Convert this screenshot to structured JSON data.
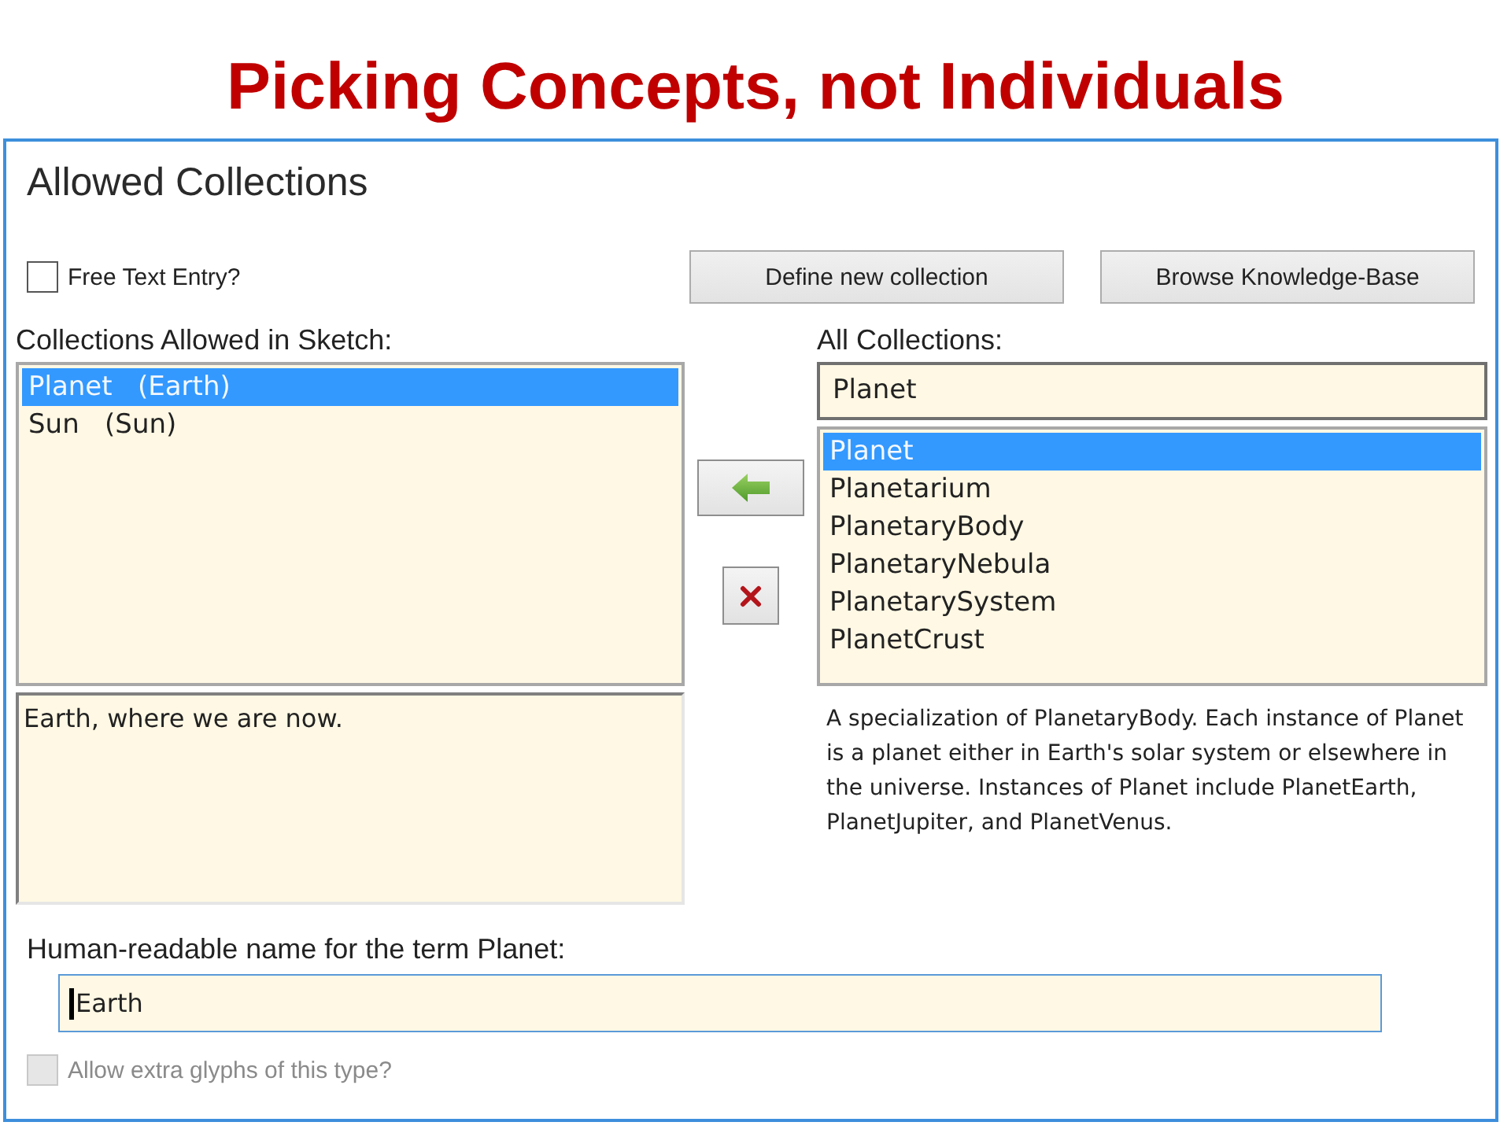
{
  "slide_title": "Picking Concepts, not Individuals",
  "dialog": {
    "title": "Allowed Collections",
    "free_text": {
      "label": "Free Text Entry?",
      "checked": false,
      "disabled": false
    },
    "buttons": [
      "Define new collection",
      "Browse Knowledge-Base"
    ],
    "allowed_list": {
      "label": "Collections Allowed in Sketch:",
      "items": [
        {
          "label": "Planet   (Earth)",
          "selected": true
        },
        {
          "label": "Sun   (Sun)",
          "selected": false
        }
      ]
    },
    "description": "Earth, where we are now.",
    "all_collections": {
      "label": "All Collections:",
      "search_value": "Planet",
      "items": [
        {
          "label": "Planet",
          "selected": true
        },
        {
          "label": "Planetarium",
          "selected": false
        },
        {
          "label": "PlanetaryBody",
          "selected": false
        },
        {
          "label": "PlanetaryNebula",
          "selected": false
        },
        {
          "label": "PlanetarySystem",
          "selected": false
        },
        {
          "label": "PlanetCrust",
          "selected": false
        }
      ]
    },
    "definition": "A specialization of PlanetaryBody. Each instance of Planet is a planet either in Earth's solar system or elsewhere in the universe. Instances of Planet include PlanetEarth, PlanetJupiter, and PlanetVenus.",
    "name_field": {
      "label": "Human-readable name for the term Planet:",
      "value": "Earth",
      "cursor": true
    },
    "extra_glyphs": {
      "label": "Allow extra glyphs of this type?",
      "checked": false,
      "disabled": true
    }
  }
}
